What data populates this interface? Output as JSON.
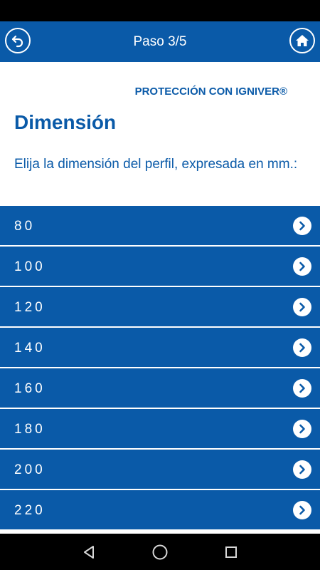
{
  "appbar": {
    "title": "Paso 3/5",
    "back_icon": "back-arrow-icon",
    "home_icon": "home-icon"
  },
  "content": {
    "brand": "PROTECCIÓN CON IGNIVER®",
    "heading": "Dimensión",
    "description": "Elija la dimensión del perfil, expresada en mm.:"
  },
  "list": {
    "items": [
      {
        "label": "80"
      },
      {
        "label": "100"
      },
      {
        "label": "120"
      },
      {
        "label": "140"
      },
      {
        "label": "160"
      },
      {
        "label": "180"
      },
      {
        "label": "200"
      },
      {
        "label": "220"
      }
    ],
    "item_icon": "chevron-right-icon"
  },
  "colors": {
    "primary": "#0a5aa8",
    "on_primary": "#ffffff",
    "status_bar": "#000000"
  },
  "navbar": {
    "back_icon": "nav-back-triangle-icon",
    "home_icon": "nav-home-circle-icon",
    "recent_icon": "nav-recents-square-icon"
  }
}
